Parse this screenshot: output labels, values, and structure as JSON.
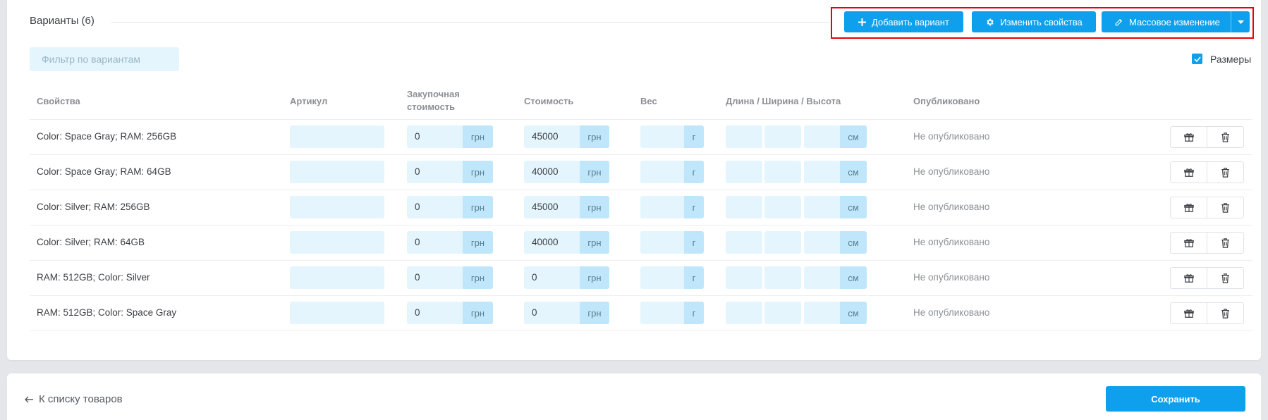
{
  "section": {
    "title": "Варианты (6)"
  },
  "toolbar": {
    "add_label": "Добавить вариант",
    "edit_label": "Изменить свойства",
    "bulk_label": "Массовое изменение"
  },
  "filter": {
    "placeholder": "Фильтр по вариантам"
  },
  "sizes_toggle": {
    "label": "Размеры",
    "checked": true
  },
  "columns": {
    "props": "Свойства",
    "sku": "Артикул",
    "purchase_line1": "Закупочная",
    "purchase_line2": "стоимость",
    "price": "Стоимость",
    "weight": "Вес",
    "dims": "Длина / Ширина / Высота",
    "published": "Опубликовано"
  },
  "units": {
    "currency": "грн",
    "weight": "г",
    "length": "см"
  },
  "rows": [
    {
      "props": "Color: Space Gray; RAM: 256GB",
      "purchase": "0",
      "price": "45000",
      "status": "Не опубликовано"
    },
    {
      "props": "Color: Space Gray; RAM: 64GB",
      "purchase": "0",
      "price": "40000",
      "status": "Не опубликовано"
    },
    {
      "props": "Color: Silver; RAM: 256GB",
      "purchase": "0",
      "price": "45000",
      "status": "Не опубликовано"
    },
    {
      "props": "Color: Silver; RAM: 64GB",
      "purchase": "0",
      "price": "40000",
      "status": "Не опубликовано"
    },
    {
      "props": "RAM: 512GB; Color: Silver",
      "purchase": "0",
      "price": "0",
      "status": "Не опубликовано"
    },
    {
      "props": "RAM: 512GB; Color: Space Gray",
      "purchase": "0",
      "price": "0",
      "status": "Не опубликовано"
    }
  ],
  "footer": {
    "back_label": "К списку товаров",
    "save_label": "Сохранить"
  },
  "colors": {
    "accent": "#0ea0ec",
    "field_bg": "#e4f5fd",
    "unit_bg": "#bfe6fa",
    "highlight": "#e8000b"
  }
}
